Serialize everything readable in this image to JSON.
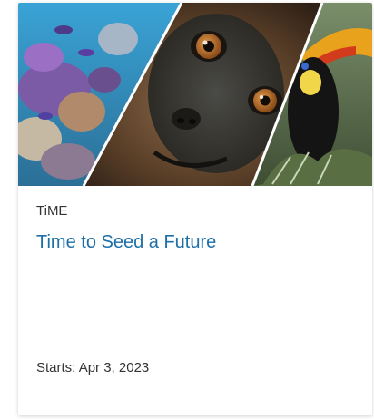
{
  "course_card": {
    "organization": "TiME",
    "title": "Time to Seed a Future",
    "start_prefix": "Starts:",
    "start_date": "Apr 3, 2023",
    "accent_color": "#1d6fa8",
    "hero_image": {
      "panels": [
        "coral-reef",
        "monkey-face",
        "toucan-bird"
      ]
    }
  }
}
